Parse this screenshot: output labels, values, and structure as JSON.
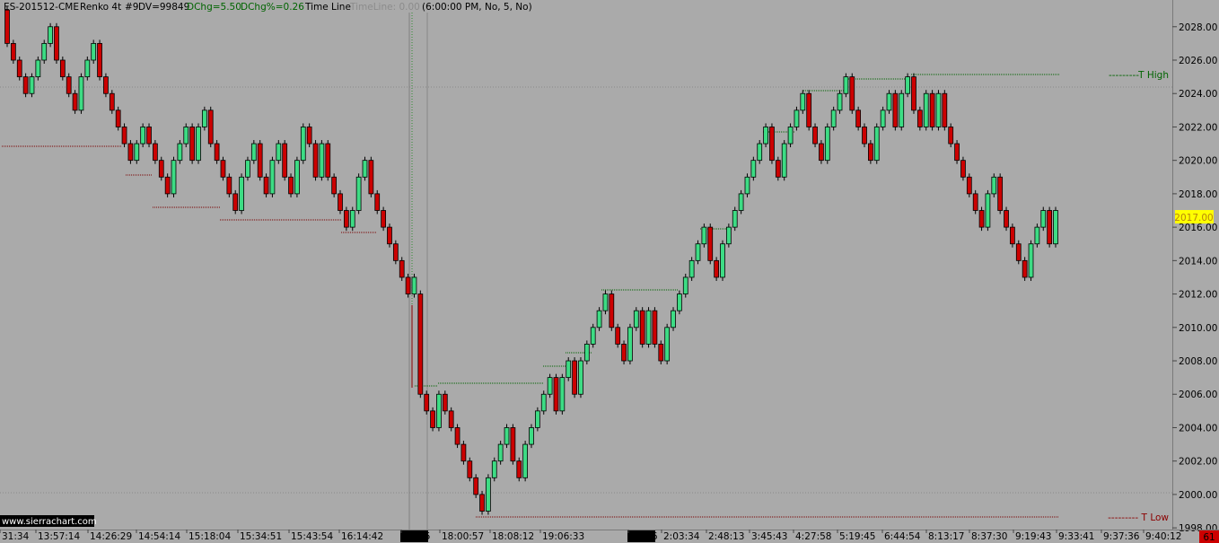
{
  "header": {
    "symbol": "ES-201512-CME",
    "bar_type": "Renko 4t",
    "study_id": "#9",
    "dv": "DV=99849",
    "dchg": "DChg=5.50",
    "dchg_pct": "DChg%=0.26",
    "time_line": "Time Line",
    "time_line_value": "TimeLine: 0.00",
    "session_info": "(6:00:00 PM, No, 5, No)"
  },
  "watermark": "www.sierrachart.com",
  "corner_badge": "61",
  "current_price_label": "2017.00",
  "price_levels": {
    "t_high_label": "---------T High",
    "t_low_label": "--------- T Low"
  },
  "colors": {
    "background": "#aaaaaa",
    "up_body": "#3ddc84",
    "down_body": "#cc0000",
    "grid": "#8a8a8a",
    "support_line": "#7a0000",
    "resistance_line": "#006400",
    "price_badge_bg": "#ffff00",
    "price_badge_fg": "#b8860b",
    "corner_badge_bg": "#cc0000"
  },
  "time_axis": {
    "labels": [
      "31:34",
      "13:57:14",
      "14:26:29",
      "14:54:14",
      "15:18:04",
      "15:34:51",
      "15:43:54",
      "16:14:42",
      "11-15",
      "18:00:57",
      "18:08:12",
      "19:06:33",
      "11-16",
      "2:03:34",
      "2:48:13",
      "3:45:43",
      "4:27:58",
      "5:19:45",
      "6:44:54",
      "8:13:17",
      "8:37:30",
      "9:19:43",
      "9:33:41",
      "9:37:36",
      "9:40:12"
    ],
    "date_markers": [
      "11-15",
      "11-16"
    ]
  },
  "chart_data": {
    "type": "candlestick",
    "subtype": "renko",
    "instrument": "ES-201512-CME",
    "brick_size": "4 ticks (1.00)",
    "y_axis": {
      "ticks": [
        "2028.00",
        "2026.00",
        "2024.00",
        "2022.00",
        "2020.00",
        "2018.00",
        "2016.00",
        "2014.00",
        "2012.00",
        "2010.00",
        "2008.00",
        "2006.00",
        "2004.00",
        "2002.00",
        "2000.00",
        "1998.00"
      ],
      "range": [
        1997.9,
        2029.6
      ]
    },
    "grid": "horizontal dotted at 2025.00 and 2000.00",
    "levels": {
      "t_high": 2025.75,
      "t_low": 1998.5
    },
    "bricks": [
      {
        "o": 2029,
        "c": 2027
      },
      {
        "o": 2027,
        "c": 2026
      },
      {
        "o": 2026,
        "c": 2025
      },
      {
        "o": 2025,
        "c": 2024
      },
      {
        "o": 2024,
        "c": 2025
      },
      {
        "o": 2025,
        "c": 2026
      },
      {
        "o": 2026,
        "c": 2027
      },
      {
        "o": 2027,
        "c": 2028
      },
      {
        "o": 2028,
        "c": 2026
      },
      {
        "o": 2026,
        "c": 2025
      },
      {
        "o": 2025,
        "c": 2024
      },
      {
        "o": 2024,
        "c": 2023
      },
      {
        "o": 2023,
        "c": 2025
      },
      {
        "o": 2025,
        "c": 2026
      },
      {
        "o": 2026,
        "c": 2027
      },
      {
        "o": 2027,
        "c": 2025
      },
      {
        "o": 2025,
        "c": 2024
      },
      {
        "o": 2024,
        "c": 2023
      },
      {
        "o": 2023,
        "c": 2022
      },
      {
        "o": 2022,
        "c": 2021
      },
      {
        "o": 2021,
        "c": 2020
      },
      {
        "o": 2020,
        "c": 2021
      },
      {
        "o": 2021,
        "c": 2022
      },
      {
        "o": 2022,
        "c": 2021
      },
      {
        "o": 2021,
        "c": 2020
      },
      {
        "o": 2020,
        "c": 2019
      },
      {
        "o": 2019,
        "c": 2018
      },
      {
        "o": 2018,
        "c": 2020
      },
      {
        "o": 2020,
        "c": 2021
      },
      {
        "o": 2021,
        "c": 2022
      },
      {
        "o": 2022,
        "c": 2020
      },
      {
        "o": 2020,
        "c": 2022
      },
      {
        "o": 2022,
        "c": 2023
      },
      {
        "o": 2023,
        "c": 2021
      },
      {
        "o": 2021,
        "c": 2020
      },
      {
        "o": 2020,
        "c": 2019
      },
      {
        "o": 2019,
        "c": 2018
      },
      {
        "o": 2018,
        "c": 2017
      },
      {
        "o": 2017,
        "c": 2019
      },
      {
        "o": 2019,
        "c": 2020
      },
      {
        "o": 2020,
        "c": 2021
      },
      {
        "o": 2021,
        "c": 2019
      },
      {
        "o": 2019,
        "c": 2018
      },
      {
        "o": 2018,
        "c": 2020
      },
      {
        "o": 2020,
        "c": 2021
      },
      {
        "o": 2021,
        "c": 2019
      },
      {
        "o": 2019,
        "c": 2018
      },
      {
        "o": 2018,
        "c": 2020
      },
      {
        "o": 2020,
        "c": 2022
      },
      {
        "o": 2022,
        "c": 2021
      },
      {
        "o": 2021,
        "c": 2019
      },
      {
        "o": 2019,
        "c": 2021
      },
      {
        "o": 2021,
        "c": 2019
      },
      {
        "o": 2019,
        "c": 2018
      },
      {
        "o": 2018,
        "c": 2017
      },
      {
        "o": 2017,
        "c": 2016
      },
      {
        "o": 2016,
        "c": 2017
      },
      {
        "o": 2017,
        "c": 2019
      },
      {
        "o": 2019,
        "c": 2020
      },
      {
        "o": 2020,
        "c": 2018
      },
      {
        "o": 2018,
        "c": 2017
      },
      {
        "o": 2017,
        "c": 2016
      },
      {
        "o": 2016,
        "c": 2015
      },
      {
        "o": 2015,
        "c": 2014
      },
      {
        "o": 2014,
        "c": 2013
      },
      {
        "o": 2013,
        "c": 2012
      },
      {
        "o": 2012,
        "c": 2013
      },
      {
        "o": 2012,
        "c": 2006
      },
      {
        "o": 2006,
        "c": 2005
      },
      {
        "o": 2005,
        "c": 2004
      },
      {
        "o": 2004,
        "c": 2006
      },
      {
        "o": 2006,
        "c": 2005
      },
      {
        "o": 2005,
        "c": 2004
      },
      {
        "o": 2004,
        "c": 2003
      },
      {
        "o": 2003,
        "c": 2002
      },
      {
        "o": 2002,
        "c": 2001
      },
      {
        "o": 2001,
        "c": 2000
      },
      {
        "o": 2000,
        "c": 1999
      },
      {
        "o": 1999,
        "c": 2001
      },
      {
        "o": 2001,
        "c": 2002
      },
      {
        "o": 2002,
        "c": 2003
      },
      {
        "o": 2003,
        "c": 2004
      },
      {
        "o": 2004,
        "c": 2002
      },
      {
        "o": 2002,
        "c": 2001
      },
      {
        "o": 2001,
        "c": 2003
      },
      {
        "o": 2003,
        "c": 2004
      },
      {
        "o": 2004,
        "c": 2005
      },
      {
        "o": 2005,
        "c": 2006
      },
      {
        "o": 2006,
        "c": 2007
      },
      {
        "o": 2007,
        "c": 2005
      },
      {
        "o": 2005,
        "c": 2007
      },
      {
        "o": 2007,
        "c": 2008
      },
      {
        "o": 2008,
        "c": 2006
      },
      {
        "o": 2006,
        "c": 2008
      },
      {
        "o": 2008,
        "c": 2009
      },
      {
        "o": 2009,
        "c": 2010
      },
      {
        "o": 2010,
        "c": 2011
      },
      {
        "o": 2011,
        "c": 2012
      },
      {
        "o": 2012,
        "c": 2010
      },
      {
        "o": 2010,
        "c": 2009
      },
      {
        "o": 2009,
        "c": 2008
      },
      {
        "o": 2008,
        "c": 2010
      },
      {
        "o": 2010,
        "c": 2011
      },
      {
        "o": 2011,
        "c": 2009
      },
      {
        "o": 2009,
        "c": 2011
      },
      {
        "o": 2011,
        "c": 2009
      },
      {
        "o": 2009,
        "c": 2008
      },
      {
        "o": 2008,
        "c": 2010
      },
      {
        "o": 2010,
        "c": 2011
      },
      {
        "o": 2011,
        "c": 2012
      },
      {
        "o": 2012,
        "c": 2013
      },
      {
        "o": 2013,
        "c": 2014
      },
      {
        "o": 2014,
        "c": 2015
      },
      {
        "o": 2015,
        "c": 2016
      },
      {
        "o": 2016,
        "c": 2014
      },
      {
        "o": 2014,
        "c": 2013
      },
      {
        "o": 2013,
        "c": 2015
      },
      {
        "o": 2015,
        "c": 2016
      },
      {
        "o": 2016,
        "c": 2017
      },
      {
        "o": 2017,
        "c": 2018
      },
      {
        "o": 2018,
        "c": 2019
      },
      {
        "o": 2019,
        "c": 2020
      },
      {
        "o": 2020,
        "c": 2021
      },
      {
        "o": 2021,
        "c": 2022
      },
      {
        "o": 2022,
        "c": 2020
      },
      {
        "o": 2020,
        "c": 2019
      },
      {
        "o": 2019,
        "c": 2021
      },
      {
        "o": 2021,
        "c": 2022
      },
      {
        "o": 2022,
        "c": 2023
      },
      {
        "o": 2023,
        "c": 2024
      },
      {
        "o": 2024,
        "c": 2022
      },
      {
        "o": 2022,
        "c": 2021
      },
      {
        "o": 2021,
        "c": 2020
      },
      {
        "o": 2020,
        "c": 2022
      },
      {
        "o": 2022,
        "c": 2023
      },
      {
        "o": 2023,
        "c": 2024
      },
      {
        "o": 2024,
        "c": 2025
      },
      {
        "o": 2025,
        "c": 2023
      },
      {
        "o": 2023,
        "c": 2022
      },
      {
        "o": 2022,
        "c": 2021
      },
      {
        "o": 2021,
        "c": 2020
      },
      {
        "o": 2020,
        "c": 2022
      },
      {
        "o": 2022,
        "c": 2023
      },
      {
        "o": 2023,
        "c": 2024
      },
      {
        "o": 2024,
        "c": 2022
      },
      {
        "o": 2022,
        "c": 2024
      },
      {
        "o": 2024,
        "c": 2025
      },
      {
        "o": 2025,
        "c": 2023
      },
      {
        "o": 2023,
        "c": 2022
      },
      {
        "o": 2022,
        "c": 2024
      },
      {
        "o": 2024,
        "c": 2022
      },
      {
        "o": 2022,
        "c": 2024
      },
      {
        "o": 2024,
        "c": 2022
      },
      {
        "o": 2022,
        "c": 2021
      },
      {
        "o": 2021,
        "c": 2020
      },
      {
        "o": 2020,
        "c": 2019
      },
      {
        "o": 2019,
        "c": 2018
      },
      {
        "o": 2018,
        "c": 2017
      },
      {
        "o": 2017,
        "c": 2016
      },
      {
        "o": 2016,
        "c": 2018
      },
      {
        "o": 2018,
        "c": 2019
      },
      {
        "o": 2019,
        "c": 2017
      },
      {
        "o": 2017,
        "c": 2016
      },
      {
        "o": 2016,
        "c": 2015
      },
      {
        "o": 2015,
        "c": 2014
      },
      {
        "o": 2014,
        "c": 2013
      },
      {
        "o": 2013,
        "c": 2015
      },
      {
        "o": 2015,
        "c": 2016
      },
      {
        "o": 2016,
        "c": 2017
      },
      {
        "o": 2017,
        "c": 2015
      },
      {
        "o": 2015,
        "c": 2017
      }
    ]
  }
}
